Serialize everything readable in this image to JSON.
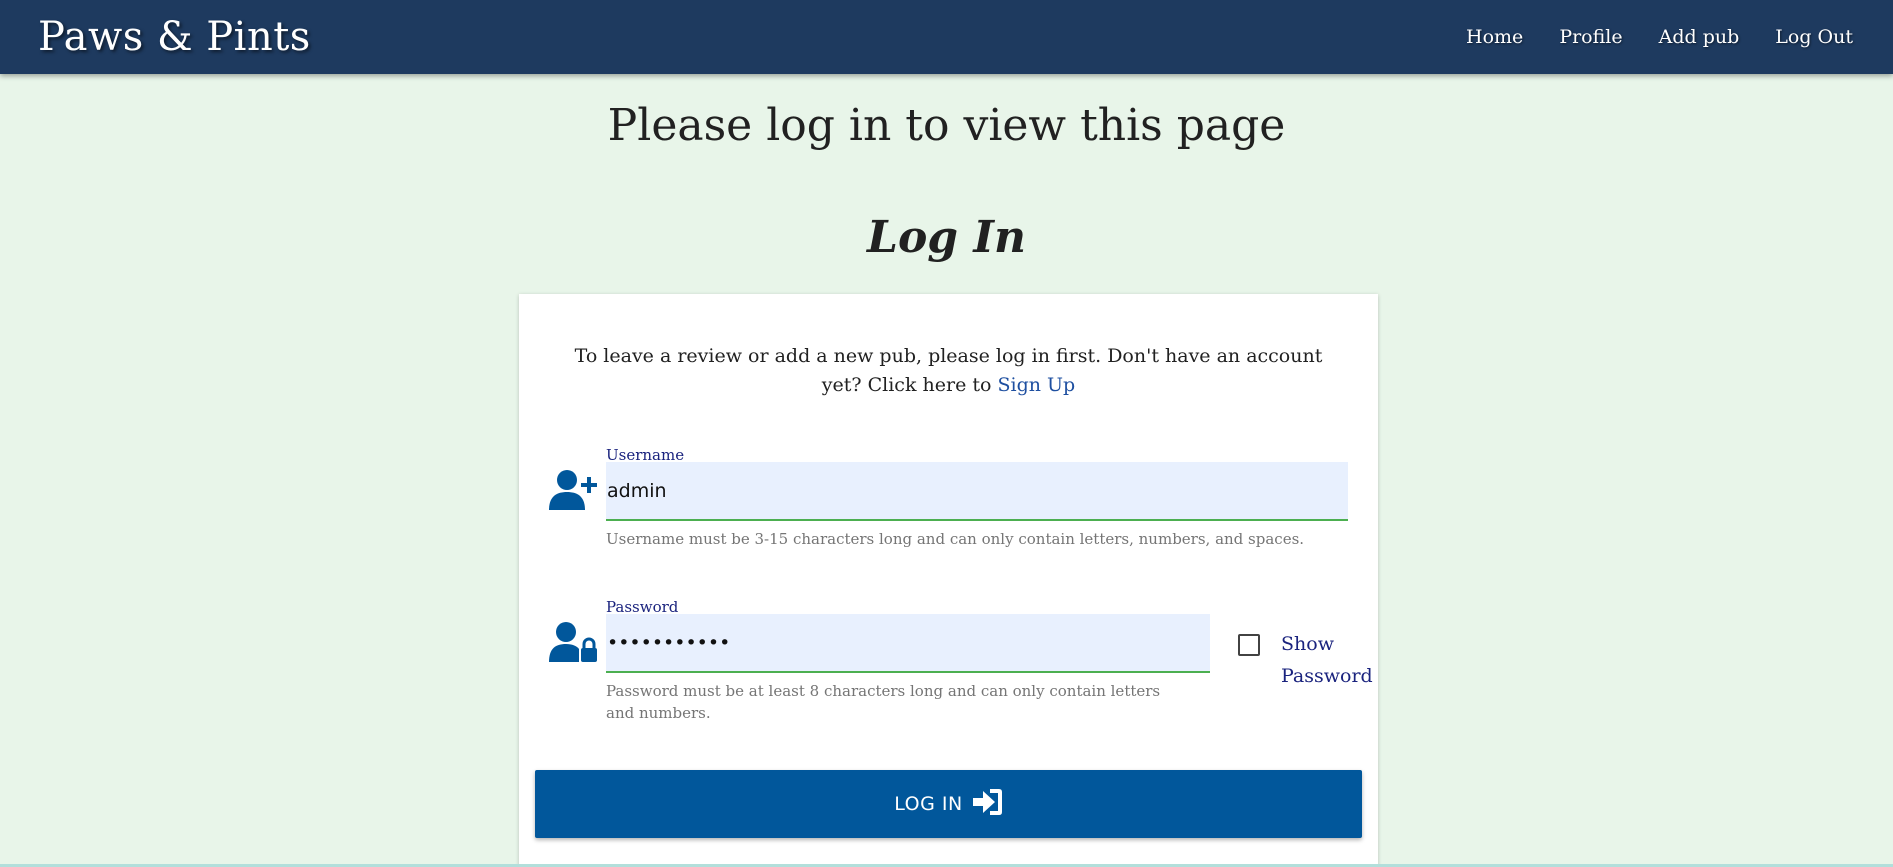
{
  "navbar": {
    "brand": "Paws & Pints",
    "links": [
      {
        "label": "Home"
      },
      {
        "label": "Profile"
      },
      {
        "label": "Add pub"
      },
      {
        "label": "Log Out"
      }
    ]
  },
  "page": {
    "heading": "Please log in to view this page",
    "form_title": "Log In"
  },
  "intro": {
    "text": "To leave a review or add a new pub, please log in first. Don't have an account yet? Click here to",
    "signup_link": "Sign Up"
  },
  "username": {
    "label": "Username",
    "value": "admin",
    "helper": "Username must be 3-15 characters long and can only contain letters, numbers, and spaces.",
    "icon": "user-plus-icon"
  },
  "password": {
    "label": "Password",
    "value": "•••••••••••",
    "helper": "Password must be at least 8 characters long and can only contain letters and numbers.",
    "icon": "user-lock-icon",
    "show_password_label": "Show Password",
    "show_password_checked": false
  },
  "login_button": {
    "label": "LOG IN",
    "icon": "sign-in-icon"
  },
  "colors": {
    "navbar": "#1e3a5f",
    "background": "#e8f5e9",
    "button": "#01579b",
    "icon": "#01579b",
    "input_underline": "#4caf50"
  }
}
